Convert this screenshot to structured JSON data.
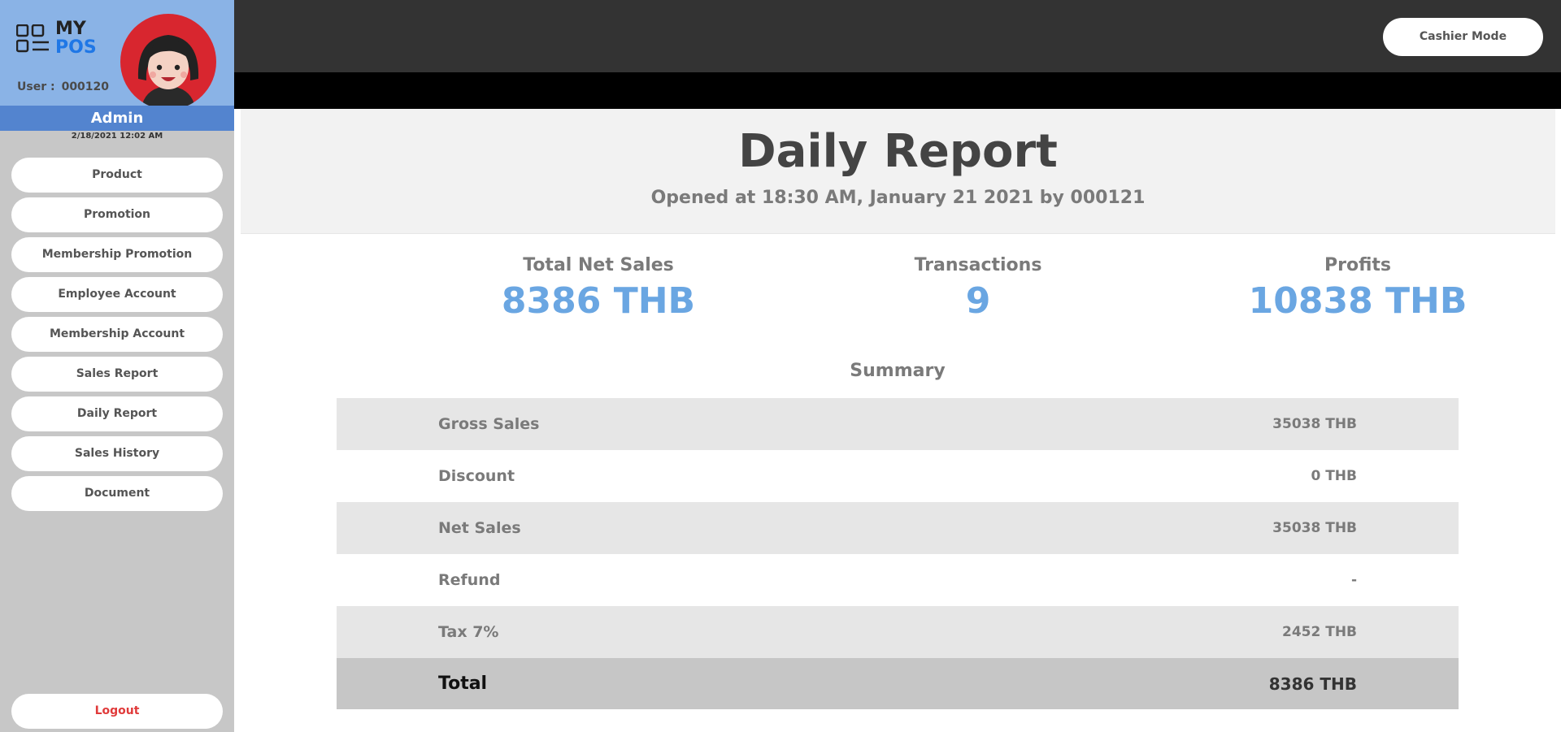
{
  "brand": {
    "logo_my": "MY",
    "logo_pos": "POS"
  },
  "user": {
    "label": "User :",
    "id": "000120",
    "role": "Admin",
    "datetime": "2/18/2021 12:02 AM"
  },
  "sidebar": {
    "items": [
      {
        "label": "Product"
      },
      {
        "label": "Promotion"
      },
      {
        "label": "Membership Promotion"
      },
      {
        "label": "Employee Account"
      },
      {
        "label": "Membership Account"
      },
      {
        "label": "Sales Report"
      },
      {
        "label": "Daily Report"
      },
      {
        "label": "Sales History"
      },
      {
        "label": "Document"
      }
    ],
    "logout_label": "Logout"
  },
  "topbar": {
    "cashier_label": "Cashier Mode"
  },
  "report": {
    "title": "Daily Report",
    "subtitle": "Opened at 18:30 AM, January 21 2021 by 000121",
    "stats": [
      {
        "label": "Total Net Sales",
        "value": "8386 THB"
      },
      {
        "label": "Transactions",
        "value": "9"
      },
      {
        "label": "Profits",
        "value": "10838 THB"
      }
    ],
    "summary_title": "Summary",
    "summary": [
      {
        "label": "Gross Sales",
        "value": "35038 THB"
      },
      {
        "label": "Discount",
        "value": "0 THB"
      },
      {
        "label": "Net Sales",
        "value": "35038 THB"
      },
      {
        "label": "Refund",
        "value": "-"
      },
      {
        "label": "Tax 7%",
        "value": "2452 THB"
      },
      {
        "label": "Total",
        "value": "8386 THB"
      }
    ]
  },
  "colors": {
    "accent": "#6aa6e2",
    "sidebar_header": "#8ab3e6",
    "admin_bar": "#5384cf",
    "logout": "#e03a3a"
  }
}
